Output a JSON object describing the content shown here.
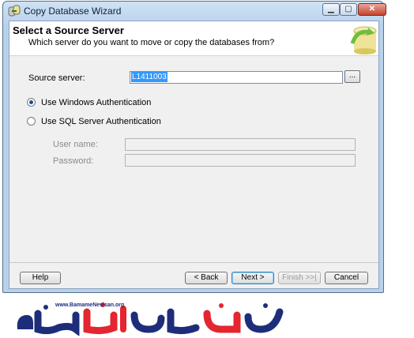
{
  "window": {
    "title": "Copy Database Wizard"
  },
  "header": {
    "title": "Select a Source Server",
    "subtitle": "Which server do you want to move or copy the databases from?"
  },
  "form": {
    "source_server_label": "Source server:",
    "source_server_value": "L1411003",
    "browse_label": "...",
    "auth_windows_label": "Use Windows Authentication",
    "auth_windows_selected": true,
    "auth_sql_label": "Use SQL Server Authentication",
    "auth_sql_selected": false,
    "username_label": "User name:",
    "username_value": "",
    "password_label": "Password:",
    "password_value": ""
  },
  "buttons": {
    "help": "Help",
    "back": "< Back",
    "next": "Next >",
    "finish": "Finish >>|",
    "cancel": "Cancel"
  },
  "logo": {
    "url": "www.BamameNevisan.org"
  },
  "colors": {
    "selection": "#3399ff",
    "logo_blue": "#1e2d7a",
    "logo_red": "#e3262f"
  }
}
